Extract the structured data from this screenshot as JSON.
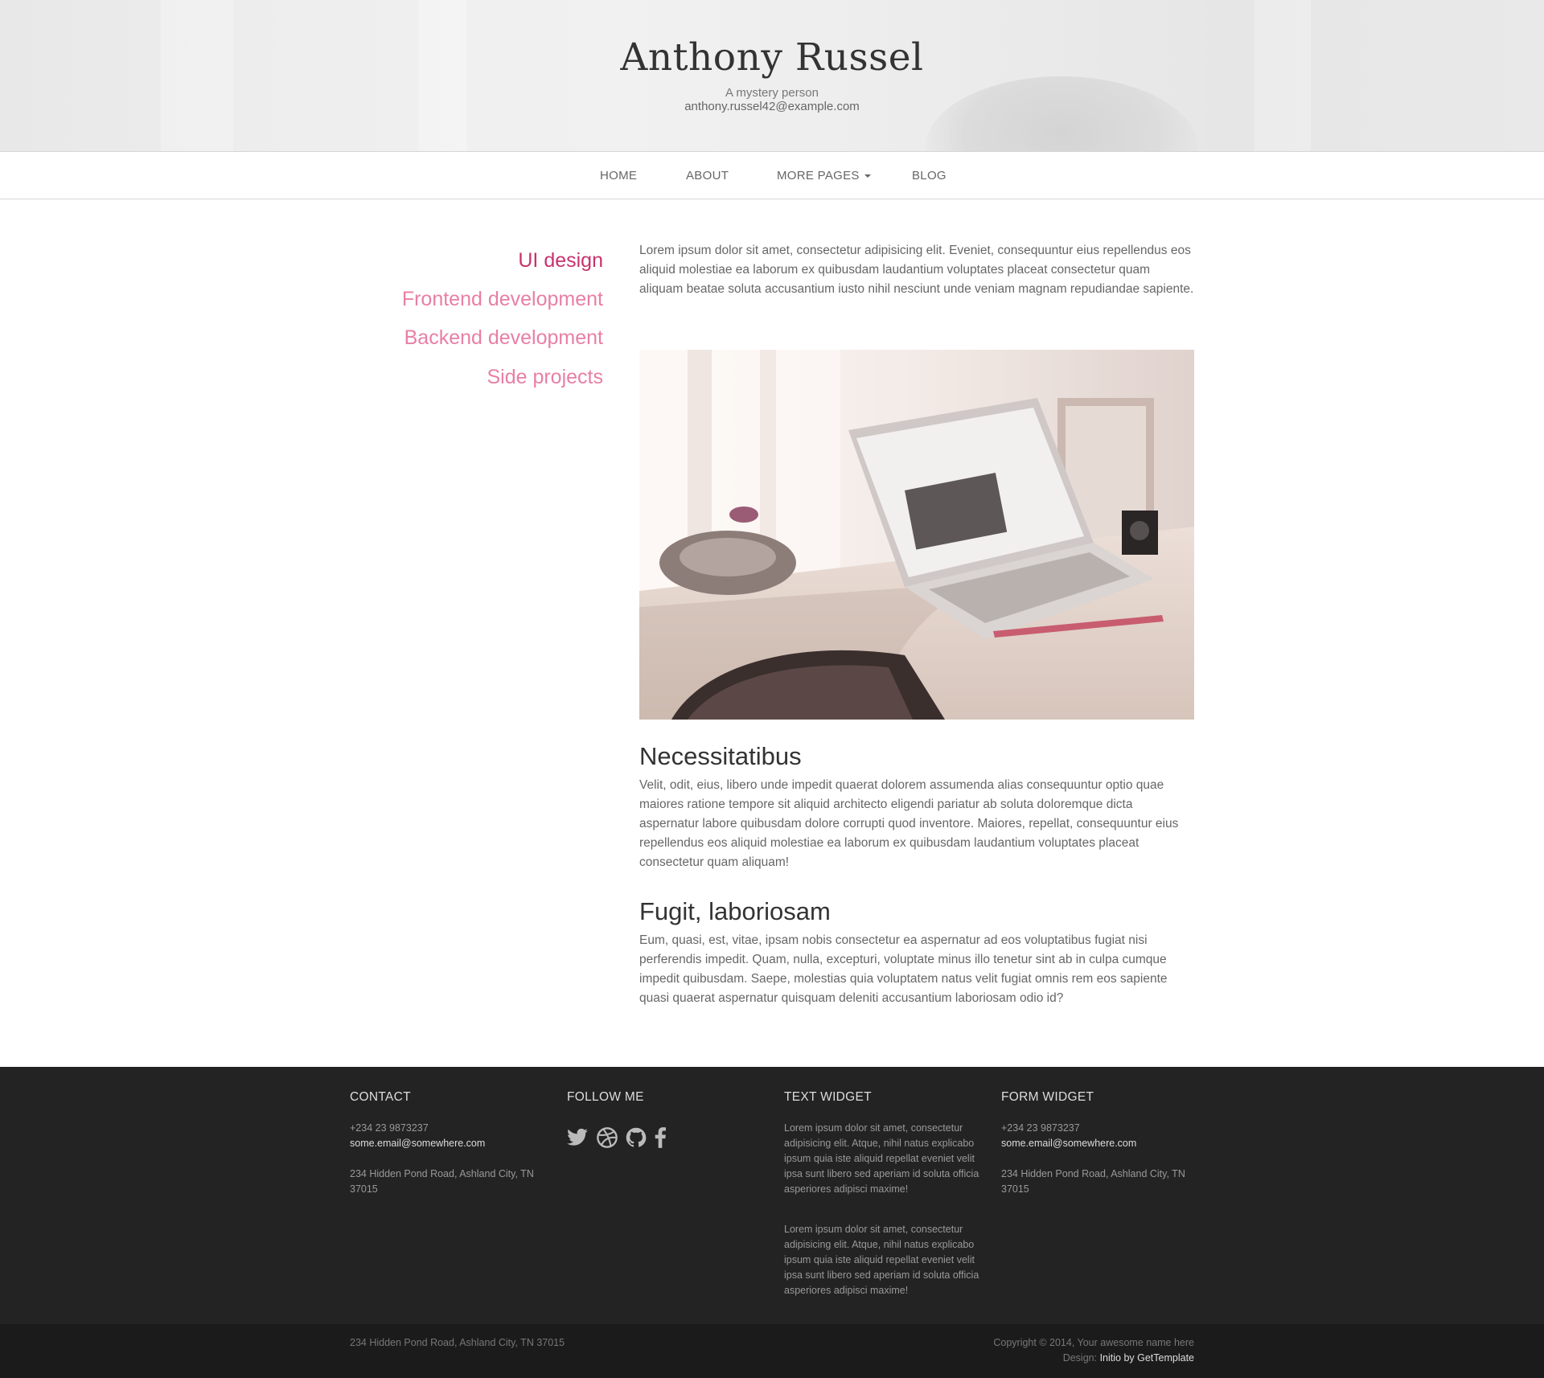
{
  "header": {
    "title": "Anthony Russel",
    "tagline": "A mystery person",
    "email": "anthony.russel42@example.com"
  },
  "nav": {
    "items": [
      {
        "label": "HOME"
      },
      {
        "label": "ABOUT"
      },
      {
        "label": "MORE PAGES"
      },
      {
        "label": "BLOG"
      }
    ]
  },
  "sidebar": {
    "items": [
      {
        "label": "UI design",
        "active": true
      },
      {
        "label": "Frontend development"
      },
      {
        "label": "Backend development"
      },
      {
        "label": "Side projects"
      }
    ]
  },
  "main": {
    "intro": "Lorem ipsum dolor sit amet, consectetur adipisicing elit. Eveniet, consequuntur eius repellendus eos aliquid molestiae ea laborum ex quibusdam laudantium voluptates placeat consectetur quam aliquam beatae soluta accusantium iusto nihil nesciunt unde veniam magnam repudiandae sapiente.",
    "sections": [
      {
        "heading": "Necessitatibus",
        "body": "Velit, odit, eius, libero unde impedit quaerat dolorem assumenda alias consequuntur optio quae maiores ratione tempore sit aliquid architecto eligendi pariatur ab soluta doloremque dicta aspernatur labore quibusdam dolore corrupti quod inventore. Maiores, repellat, consequuntur eius repellendus eos aliquid molestiae ea laborum ex quibusdam laudantium voluptates placeat consectetur quam aliquam!"
      },
      {
        "heading": "Fugit, laboriosam",
        "body": "Eum, quasi, est, vitae, ipsam nobis consectetur ea aspernatur ad eos voluptatibus fugiat nisi perferendis impedit. Quam, nulla, excepturi, voluptate minus illo tenetur sint ab in culpa cumque impedit quibusdam. Saepe, molestias quia voluptatem natus velit fugiat omnis rem eos sapiente quasi quaerat aspernatur quisquam deleniti accusantium laboriosam odio id?"
      }
    ]
  },
  "footer": {
    "contact": {
      "heading": "CONTACT",
      "phone": "+234 23 9873237",
      "email": "some.email@somewhere.com",
      "address": "234 Hidden Pond Road, Ashland City, TN 37015"
    },
    "follow": {
      "heading": "FOLLOW ME",
      "icons": [
        "twitter-icon",
        "dribbble-icon",
        "github-icon",
        "facebook-icon"
      ]
    },
    "text_widget": {
      "heading": "TEXT WIDGET",
      "p1": "Lorem ipsum dolor sit amet, consectetur adipisicing elit. Atque, nihil natus explicabo ipsum quia iste aliquid repellat eveniet velit ipsa sunt libero sed aperiam id soluta officia asperiores adipisci maxime!",
      "p2": "Lorem ipsum dolor sit amet, consectetur adipisicing elit. Atque, nihil natus explicabo ipsum quia iste aliquid repellat eveniet velit ipsa sunt libero sed aperiam id soluta officia asperiores adipisci maxime!"
    },
    "form_widget": {
      "heading": "FORM WIDGET",
      "phone": "+234 23 9873237",
      "email": "some.email@somewhere.com",
      "address": "234 Hidden Pond Road, Ashland City, TN 37015"
    },
    "bottom": {
      "address": "234 Hidden Pond Road, Ashland City, TN 37015",
      "copyright": "Copyright © 2014, Your awesome name here",
      "design_prefix": "Design:",
      "design_link": "Initio by GetTemplate"
    }
  },
  "colors": {
    "accent_active": "#c7336b",
    "accent": "#e87fa5",
    "footer_bg": "#232323",
    "footer_bottom_bg": "#1b1b1b"
  }
}
